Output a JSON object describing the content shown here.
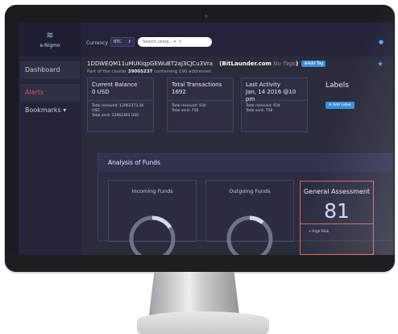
{
  "app": {
    "name": "e-Nigmo"
  },
  "topbar": {
    "currency_label": "Currency",
    "currency_value": "BTC",
    "search_placeholder": "Search using... ▾"
  },
  "sidebar": {
    "items": [
      {
        "label": "Dashboard"
      },
      {
        "label": "Alerts"
      },
      {
        "label": "Bookmarks ▾"
      }
    ]
  },
  "address": {
    "value": "1DDWEQM11uMUKiqpGEWuBT2aJ3CJCu3Vra",
    "site": "BitLaunder.com",
    "no_tags": "No Tags",
    "add_tag": "Add Tag",
    "cluster_prefix": "Part of the cluster",
    "cluster_id": "39005237",
    "cluster_suffix": "containing 190 addresses"
  },
  "cards": [
    {
      "title": "Current Balance",
      "value": "0 USD",
      "lines": [
        "Total received: 12962373.36 USD",
        "Total sent: 12962363 USD"
      ]
    },
    {
      "title": "Total Transactions",
      "value": "1692",
      "lines": [
        "Total received: 934",
        "Total sent: 758"
      ]
    },
    {
      "title": "Last Activity",
      "value": "Jan, 14 2016 @10 pm",
      "lines": [
        "Total received: 934",
        "Total sent: 758"
      ]
    }
  ],
  "labels_section": {
    "title": "Labels",
    "add_label": "Add Label"
  },
  "analysis": {
    "title": "Analysis of Funds",
    "incoming_title": "Incoming Funds",
    "outgoing_title": "Outgoing Funds",
    "assessment_title": "General Assessment",
    "assessment_score": "81",
    "risk_item": "High Risk"
  },
  "colors": {
    "accent": "#3a8fdc",
    "alert": "#e34d57",
    "assessment_border": "#d66a55",
    "background": "#2a2b3b"
  },
  "icons": [
    "logo-mark-icon",
    "chevron-down-icon",
    "search-icon",
    "user-icon",
    "star-icon",
    "plus-icon",
    "chevron-down-icon"
  ]
}
